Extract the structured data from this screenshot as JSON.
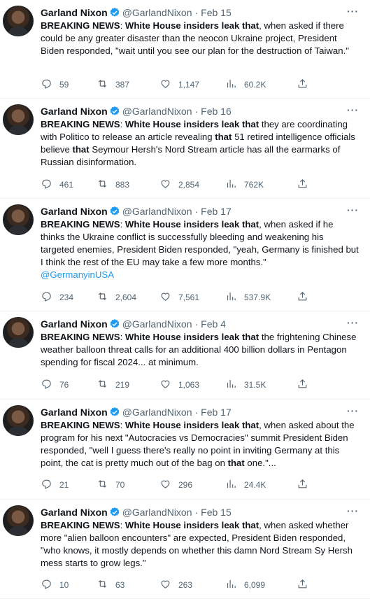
{
  "tweets": [
    {
      "name": "Garland Nixon",
      "handle": "@GarlandNixon",
      "sep": "·",
      "date": "Feb 15",
      "segments": [
        {
          "t": "BREAKING NEWS",
          "b": true
        },
        {
          "t": ": "
        },
        {
          "t": "White House insiders leak that",
          "b": true
        },
        {
          "t": ", when asked if there could be any greater disaster than the neocon Ukraine project, President Biden responded, \"wait until you see our plan for the destruction of Taiwan.\""
        }
      ],
      "replies": "59",
      "retweets": "387",
      "likes": "1,147",
      "views": "60.2K"
    },
    {
      "name": "Garland Nixon",
      "handle": "@GarlandNixon",
      "sep": "·",
      "date": "Feb 16",
      "segments": [
        {
          "t": "BREAKING NEWS",
          "b": true
        },
        {
          "t": ": "
        },
        {
          "t": "White House insiders leak that",
          "b": true
        },
        {
          "t": " they are coordinating with Politico to release an article revealing "
        },
        {
          "t": "that",
          "b": true
        },
        {
          "t": " 51 retired intelligence officials believe "
        },
        {
          "t": "that",
          "b": true
        },
        {
          "t": " Seymour Hersh's Nord Stream article has all the earmarks of Russian disinformation."
        }
      ],
      "replies": "461",
      "retweets": "883",
      "likes": "2,854",
      "views": "762K"
    },
    {
      "name": "Garland Nixon",
      "handle": "@GarlandNixon",
      "sep": "·",
      "date": "Feb 17",
      "segments": [
        {
          "t": "BREAKING NEWS",
          "b": true
        },
        {
          "t": ": "
        },
        {
          "t": "White House insiders leak that",
          "b": true
        },
        {
          "t": ", when asked if he thinks the Ukraine conflict is successfully bleeding and weakening his targeted enemies, President Biden responded, \"yeah, Germany is finished but I think the rest of the EU may take a few more months.\""
        },
        {
          "t": "@GermanyinUSA",
          "m": true,
          "br": true
        }
      ],
      "replies": "234",
      "retweets": "2,604",
      "likes": "7,561",
      "views": "537.9K"
    },
    {
      "name": "Garland Nixon",
      "handle": "@GarlandNixon",
      "sep": "·",
      "date": "Feb 4",
      "segments": [
        {
          "t": "BREAKING NEWS",
          "b": true
        },
        {
          "t": ": "
        },
        {
          "t": "White House insiders leak that",
          "b": true
        },
        {
          "t": " the frightening Chinese weather balloon threat calls for an additional 400 billion dollars in Pentagon spending for fiscal 2024... at minimum."
        }
      ],
      "replies": "76",
      "retweets": "219",
      "likes": "1,063",
      "views": "31.5K"
    },
    {
      "name": "Garland Nixon",
      "handle": "@GarlandNixon",
      "sep": "·",
      "date": "Feb 17",
      "segments": [
        {
          "t": "BREAKING NEWS",
          "b": true
        },
        {
          "t": ": "
        },
        {
          "t": "White House insiders leak that",
          "b": true
        },
        {
          "t": ", when asked about the program for his next \"Autocracies vs Democracies\" summit President Biden responded, \"well I guess there's really no point in inviting Germany at this point, the cat is pretty much out of the bag on "
        },
        {
          "t": "that",
          "b": true
        },
        {
          "t": " one.\"..."
        }
      ],
      "replies": "21",
      "retweets": "70",
      "likes": "296",
      "views": "24.4K"
    },
    {
      "name": "Garland Nixon",
      "handle": "@GarlandNixon",
      "sep": "·",
      "date": "Feb 15",
      "segments": [
        {
          "t": "BREAKING NEWS",
          "b": true
        },
        {
          "t": ": "
        },
        {
          "t": "White House insiders leak that",
          "b": true
        },
        {
          "t": ", when asked whether more \"alien balloon encounters\" are expected, President Biden responded, \"who knows, it mostly depends on whether this damn Nord Stream Sy Hersh mess starts to grow legs.\""
        }
      ],
      "replies": "10",
      "retweets": "63",
      "likes": "263",
      "views": "6,099"
    }
  ],
  "more_glyph": "···",
  "colors": {
    "accent": "#1d9bf0",
    "text": "#0f1419",
    "muted": "#536471",
    "divider": "#eff3f4"
  }
}
